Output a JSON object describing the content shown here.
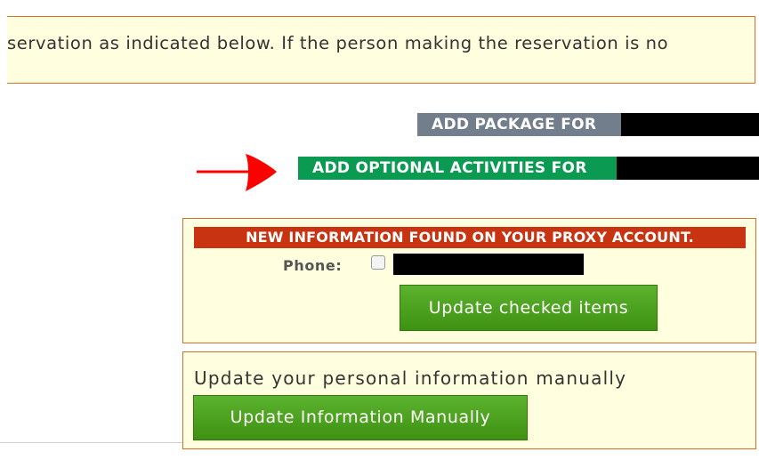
{
  "notice": {
    "text": "servation as indicated below.  If the person making the reservation is no"
  },
  "buttons": {
    "add_package": "ADD PACKAGE FOR",
    "add_activities": "ADD OPTIONAL ACTIVITIES FOR"
  },
  "proxy": {
    "header": "NEW INFORMATION FOUND ON YOUR PROXY ACCOUNT.",
    "phone_label": "Phone:",
    "phone_checked": false,
    "update_button": "Update checked items"
  },
  "manual": {
    "text": "Update your personal information manually",
    "button": "Update Information Manually"
  },
  "colors": {
    "package_bg": "#727e8c",
    "activities_bg": "#0a9a52",
    "proxy_header_bg": "#c83412",
    "box_bg": "#ffffe0",
    "box_border": "#d4702e",
    "green_button": "#4ca01f",
    "arrow": "#ff0000"
  }
}
